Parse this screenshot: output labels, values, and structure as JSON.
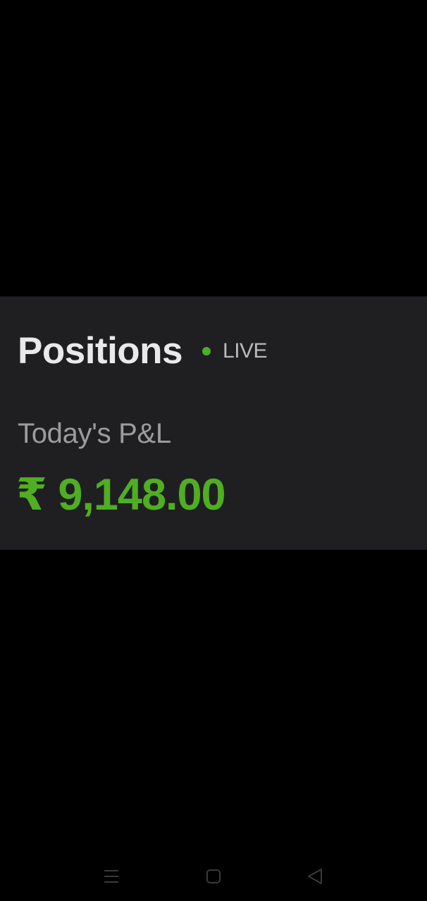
{
  "positions_card": {
    "title": "Positions",
    "live_label": "LIVE",
    "pnl_label": "Today's P&L",
    "pnl_value": "₹ 9,148.00"
  },
  "nav_bar": {
    "icons": [
      "menu-icon",
      "home-icon",
      "back-icon"
    ]
  },
  "colors": {
    "background": "#000000",
    "card_background": "#1f1f21",
    "profit_green": "#4fae22",
    "live_dot_green": "#4caf2a",
    "title_text": "#e9e9e9",
    "secondary_text": "#9c9c9c"
  }
}
